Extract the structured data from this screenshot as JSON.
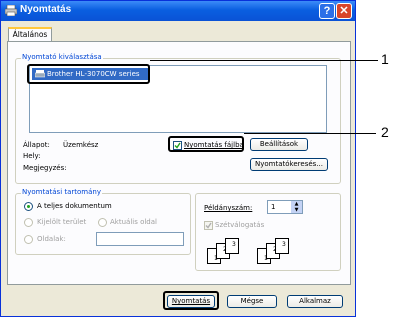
{
  "window": {
    "title": "Nyomtatás",
    "help_glyph": "?",
    "close_glyph": "✕"
  },
  "tabs": [
    {
      "label": "Általános"
    }
  ],
  "printer_select": {
    "group_label": "Nyomtató kiválasztása",
    "printers": [
      {
        "name": "Brother HL-3070CW series",
        "selected": true
      }
    ]
  },
  "status": {
    "allapot_label": "Állapot:",
    "allapot_value": "Üzemkész",
    "hely_label": "Hely:",
    "megjegyzes_label": "Megjegyzés:"
  },
  "print_to_file": {
    "label": "Nyomtatás fájlba",
    "checked": true
  },
  "buttons": {
    "settings": "Beállítások",
    "find_printer": "Nyomtatókeresés...",
    "print": "Nyomtatás",
    "cancel": "Mégse",
    "apply": "Alkalmaz"
  },
  "page_range": {
    "group_label": "Nyomtatási tartomány",
    "all": "A teljes dokumentum",
    "selection": "Kijelölt terület",
    "current": "Aktuális oldal",
    "pages": "Oldalak:",
    "pages_value": ""
  },
  "copies": {
    "label": "Példányszám:",
    "value": "1",
    "collate_label": "Szétválogatás",
    "collate_checked": true,
    "collate_digits": [
      "1",
      "2",
      "3"
    ]
  },
  "callouts": {
    "one": "1",
    "two": "2"
  },
  "colors": {
    "titlebar": "#0a5fe0",
    "selection": "#316ac5",
    "group_label": "#0046d5"
  }
}
